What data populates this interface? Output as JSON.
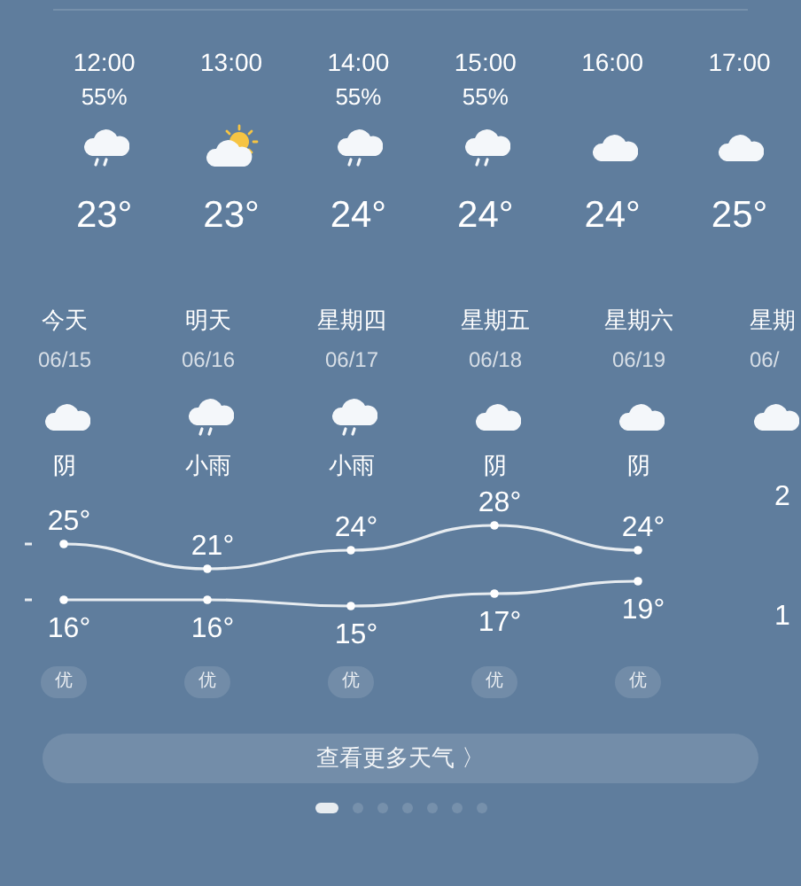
{
  "hourly": [
    {
      "time": "12:00",
      "precip": "55%",
      "kind": "rain",
      "temp": "23°"
    },
    {
      "time": "13:00",
      "kind": "partly_sunny",
      "temp": "23°"
    },
    {
      "time": "14:00",
      "precip": "55%",
      "kind": "rain",
      "temp": "24°"
    },
    {
      "time": "15:00",
      "precip": "55%",
      "kind": "rain",
      "temp": "24°"
    },
    {
      "time": "16:00",
      "kind": "cloudy",
      "temp": "24°"
    },
    {
      "time": "17:00",
      "kind": "cloudy",
      "temp": "25°"
    }
  ],
  "daily": [
    {
      "day": "今天",
      "date": "06/15",
      "kind": "cloudy",
      "condition": "阴",
      "aqi": "优"
    },
    {
      "day": "明天",
      "date": "06/16",
      "kind": "rain",
      "condition": "小雨",
      "aqi": "优"
    },
    {
      "day": "星期四",
      "date": "06/17",
      "kind": "rain",
      "condition": "小雨",
      "aqi": "优"
    },
    {
      "day": "星期五",
      "date": "06/18",
      "kind": "cloudy",
      "condition": "阴",
      "aqi": "优"
    },
    {
      "day": "星期六",
      "date": "06/19",
      "kind": "cloudy",
      "condition": "阴",
      "aqi": "优"
    },
    {
      "day": "星期",
      "date": "06/",
      "kind": "cloudy",
      "high": "2",
      "low": "1"
    }
  ],
  "chart_data": {
    "type": "line",
    "series": [
      {
        "color": "#ffffff",
        "marker": true,
        "values": [
          25,
          21,
          24,
          28,
          24,
          null
        ],
        "value_labels": [
          "25°",
          "21°",
          "24°",
          "28°",
          "24°",
          null
        ]
      },
      {
        "color": "#ffffff",
        "marker": true,
        "values": [
          16,
          16,
          15,
          17,
          19,
          null
        ],
        "value_labels": [
          "16°",
          "16°",
          "15°",
          "17°",
          "19°",
          null
        ]
      }
    ]
  },
  "more_button": {
    "label": "查看更多天气 〉"
  },
  "pages": [
    {
      "selected": true
    },
    {
      "selected": false
    },
    {
      "selected": false
    },
    {
      "selected": false
    },
    {
      "selected": false
    },
    {
      "selected": false
    },
    {
      "selected": false
    }
  ]
}
